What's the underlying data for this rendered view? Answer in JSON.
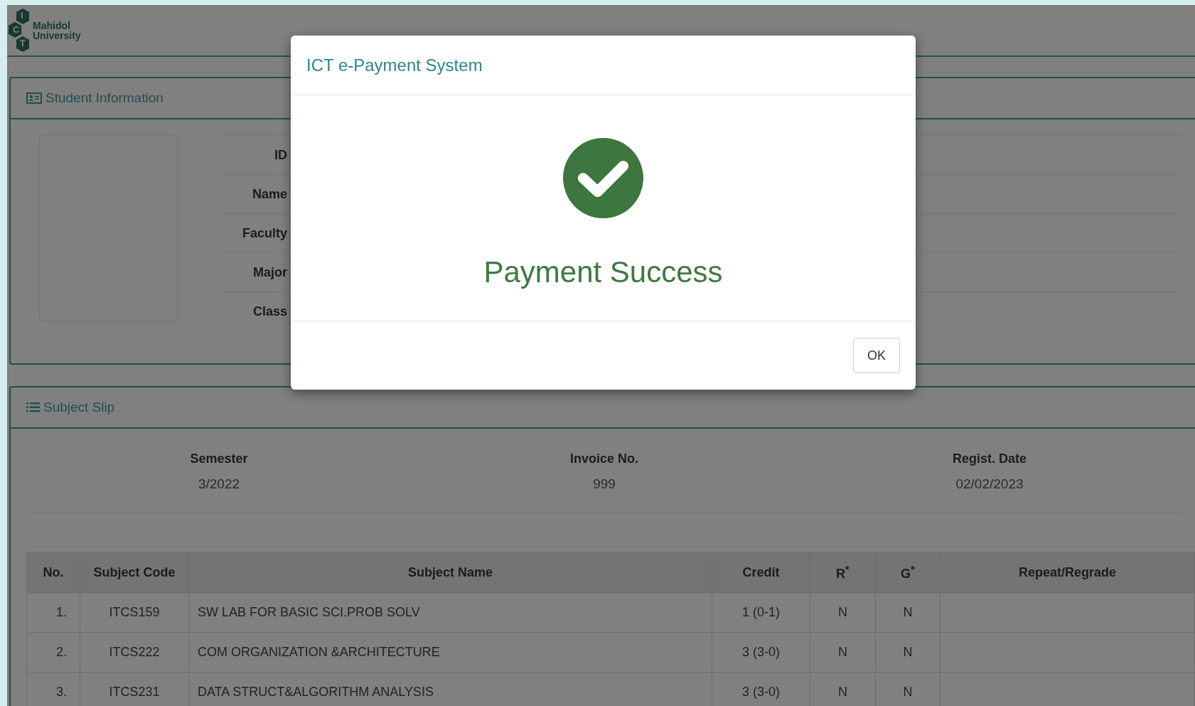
{
  "header": {
    "logo_letters": [
      "I",
      "C",
      "T"
    ],
    "logo_text": [
      "Mahidol",
      "University"
    ]
  },
  "student_information": {
    "title": "Student Information",
    "fields": [
      "ID",
      "Name",
      "Faculty",
      "Major",
      "Class"
    ]
  },
  "subject_slip": {
    "title": "Subject Slip",
    "summary": [
      {
        "label": "Semester",
        "value": "3/2022"
      },
      {
        "label": "Invoice No.",
        "value": "999"
      },
      {
        "label": "Regist. Date",
        "value": "02/02/2023"
      }
    ],
    "table": {
      "columns": [
        "No.",
        "Subject Code",
        "Subject Name",
        "Credit",
        "R$^{*}$",
        "G$^{*}$",
        "Repeat/Regrade"
      ],
      "rows": [
        {
          "no": "1.",
          "code": "ITCS159",
          "name": "SW LAB FOR BASIC SCI.PROB SOLV",
          "credit": "1 (0-1)",
          "r": "N",
          "g": "N"
        },
        {
          "no": "2.",
          "code": "ITCS222",
          "name": "COM ORGANIZATION &ARCHITECTURE",
          "credit": "3 (3-0)",
          "r": "N",
          "g": "N"
        },
        {
          "no": "3.",
          "code": "ITCS231",
          "name": "DATA STRUCT&ALGORITHM ANALYSIS",
          "credit": "3 (3-0)",
          "r": "N",
          "g": "N"
        }
      ]
    }
  },
  "dialog": {
    "title": "ICT e-Payment System",
    "message": "Payment Success",
    "buttons": [
      "OK"
    ]
  }
}
